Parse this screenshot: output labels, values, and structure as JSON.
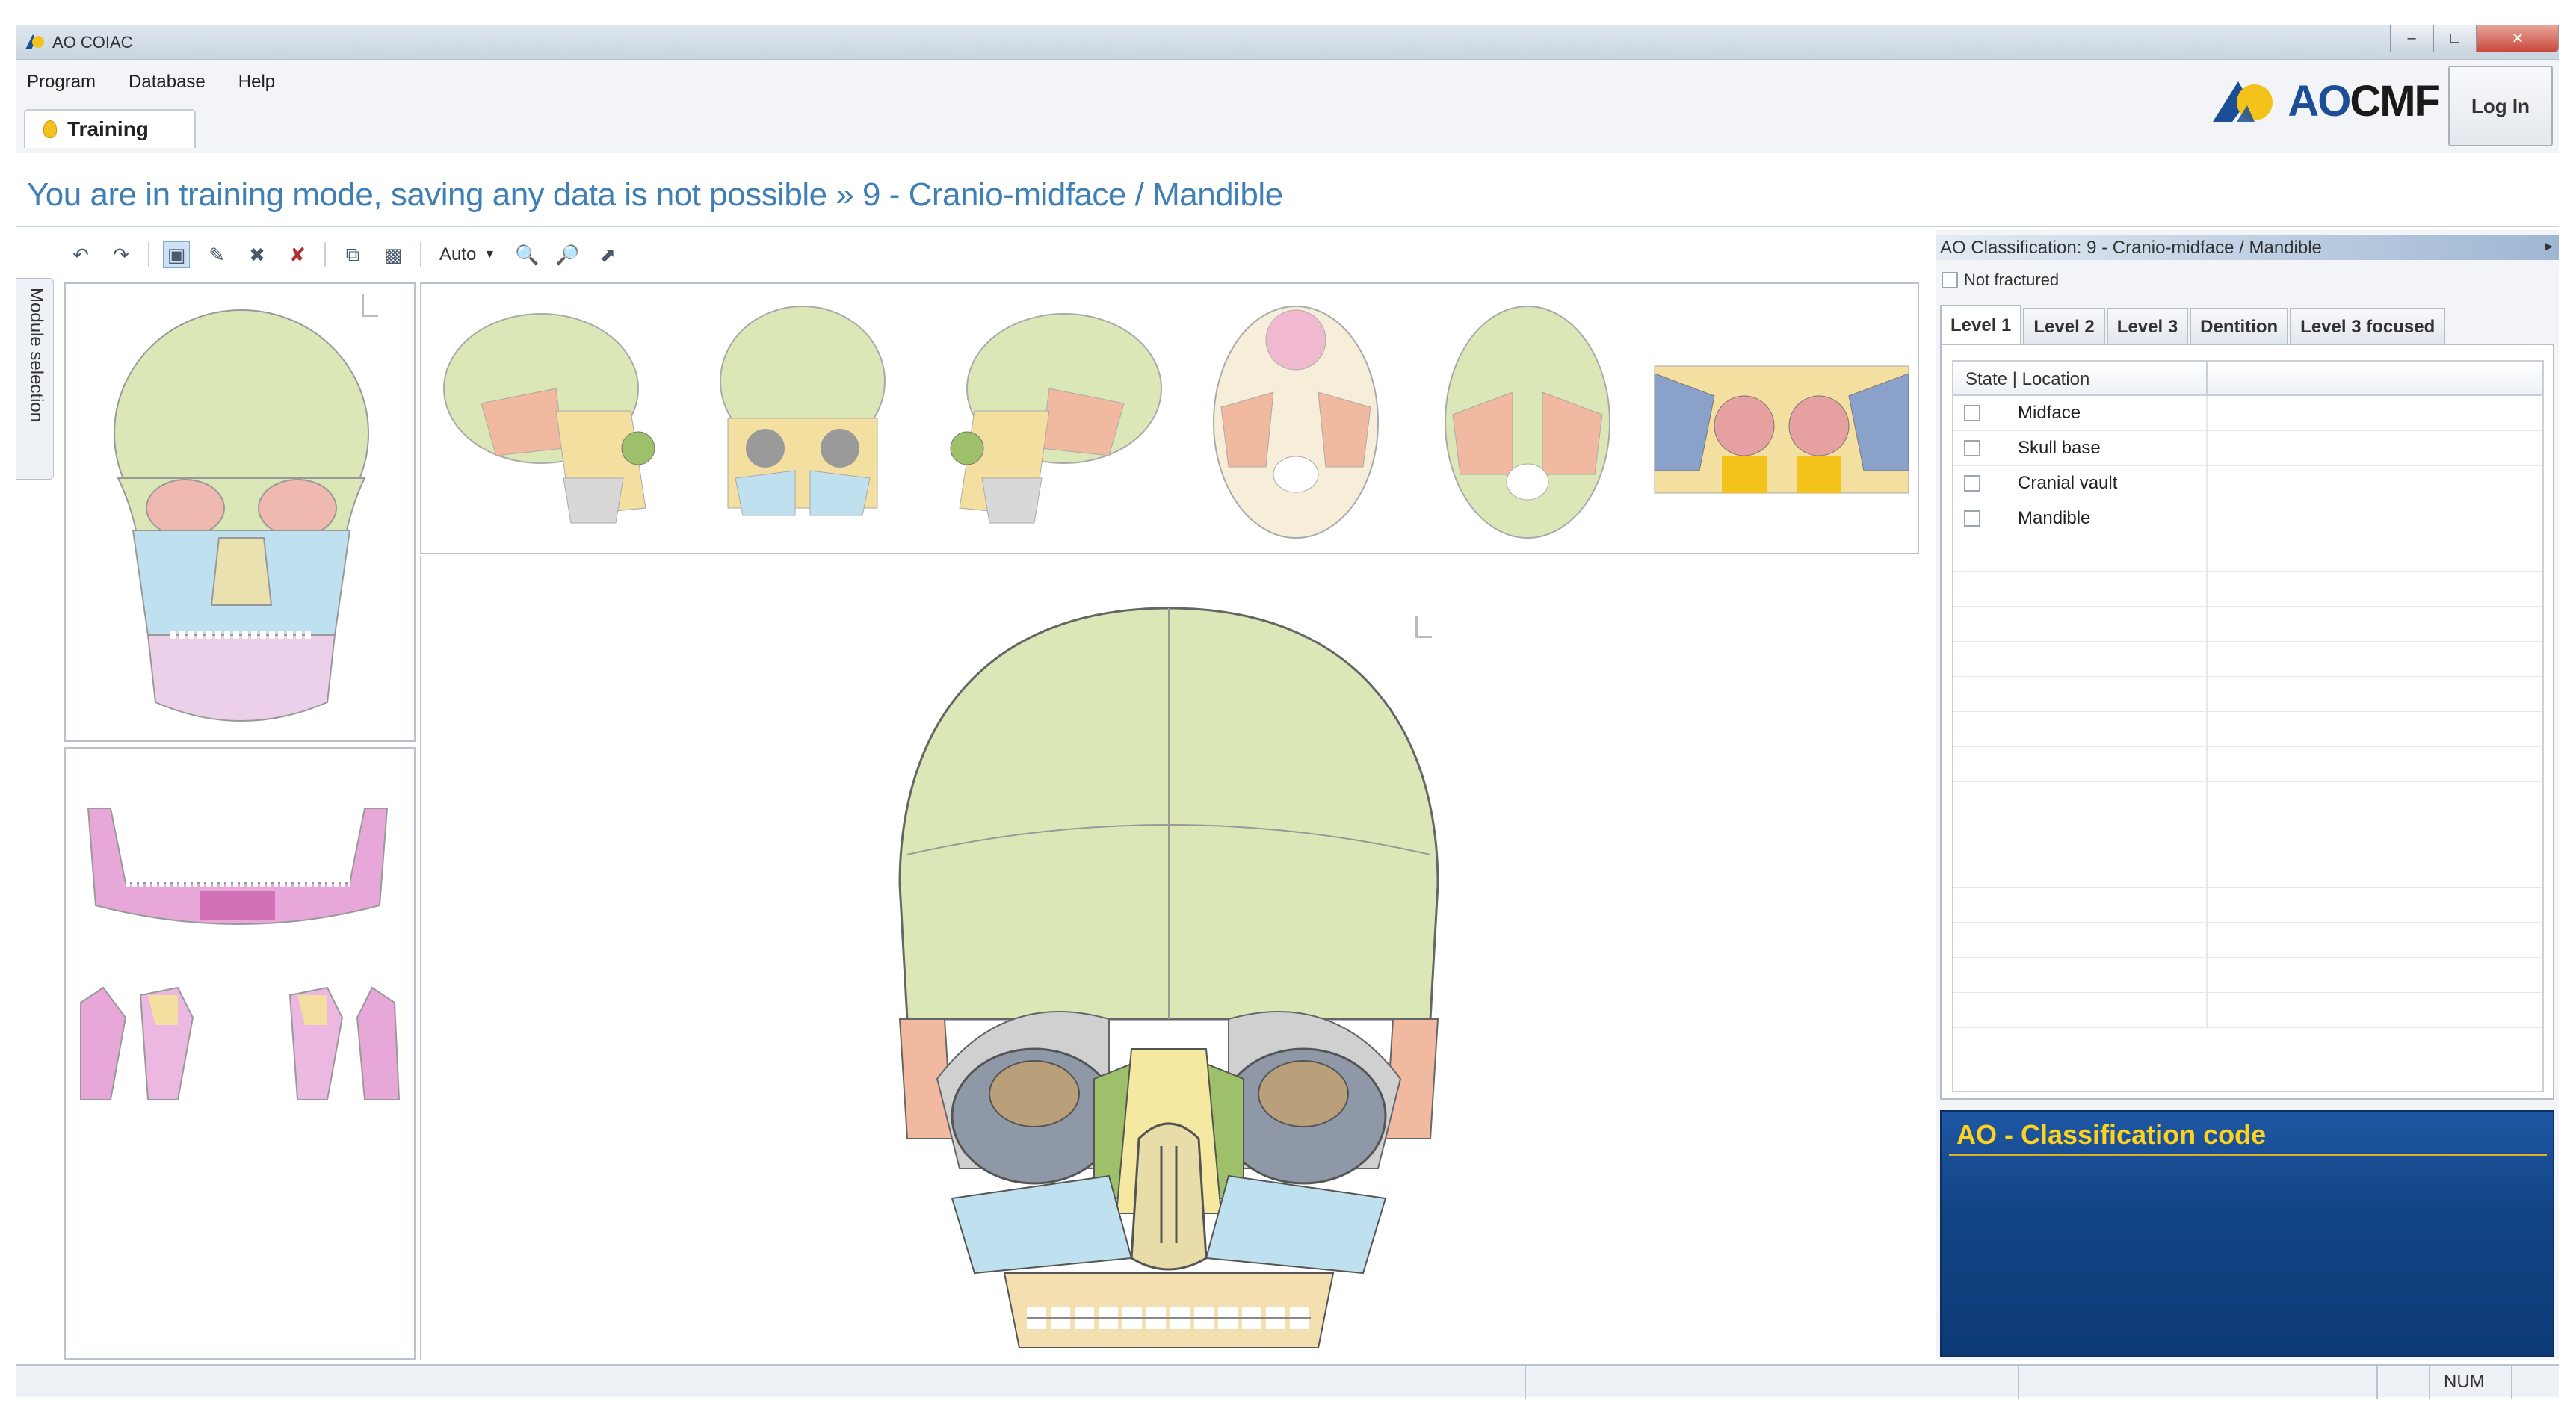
{
  "window": {
    "title": "AO COIAC"
  },
  "menu": [
    "Program",
    "Database",
    "Help"
  ],
  "mode_tab": {
    "label": "Training"
  },
  "brand": {
    "logo_ao": "AO",
    "logo_cmf": "CMF",
    "login_label": "Log In"
  },
  "banner": {
    "text": "You are in training mode, saving any data is not possible  »  9 - Cranio-midface / Mandible"
  },
  "toolbar": {
    "zoom_mode": "Auto"
  },
  "side_strip": {
    "label": "Module selection"
  },
  "classification": {
    "header": "AO Classification: 9 - Cranio-midface / Mandible",
    "not_fractured_label": "Not fractured",
    "tabs": [
      "Level 1",
      "Level 2",
      "Level 3",
      "Dentition",
      "Level 3 focused"
    ],
    "active_tab": "Level 1",
    "grid_header": "State | Location",
    "rows": [
      "Midface",
      "Skull base",
      "Cranial vault",
      "Mandible"
    ]
  },
  "code_panel": {
    "title": "AO - Classification code"
  },
  "status": {
    "num": "NUM"
  },
  "colors": {
    "vault": "#dbe7b6",
    "maxilla": "#f3dfa0",
    "orbit_blue": "#b7d8e7",
    "zygoma": "#f2c7a0",
    "mandible_pink": "#e8bfe0",
    "code_panel": "#124586",
    "banner_text": "#3f7fb5"
  }
}
